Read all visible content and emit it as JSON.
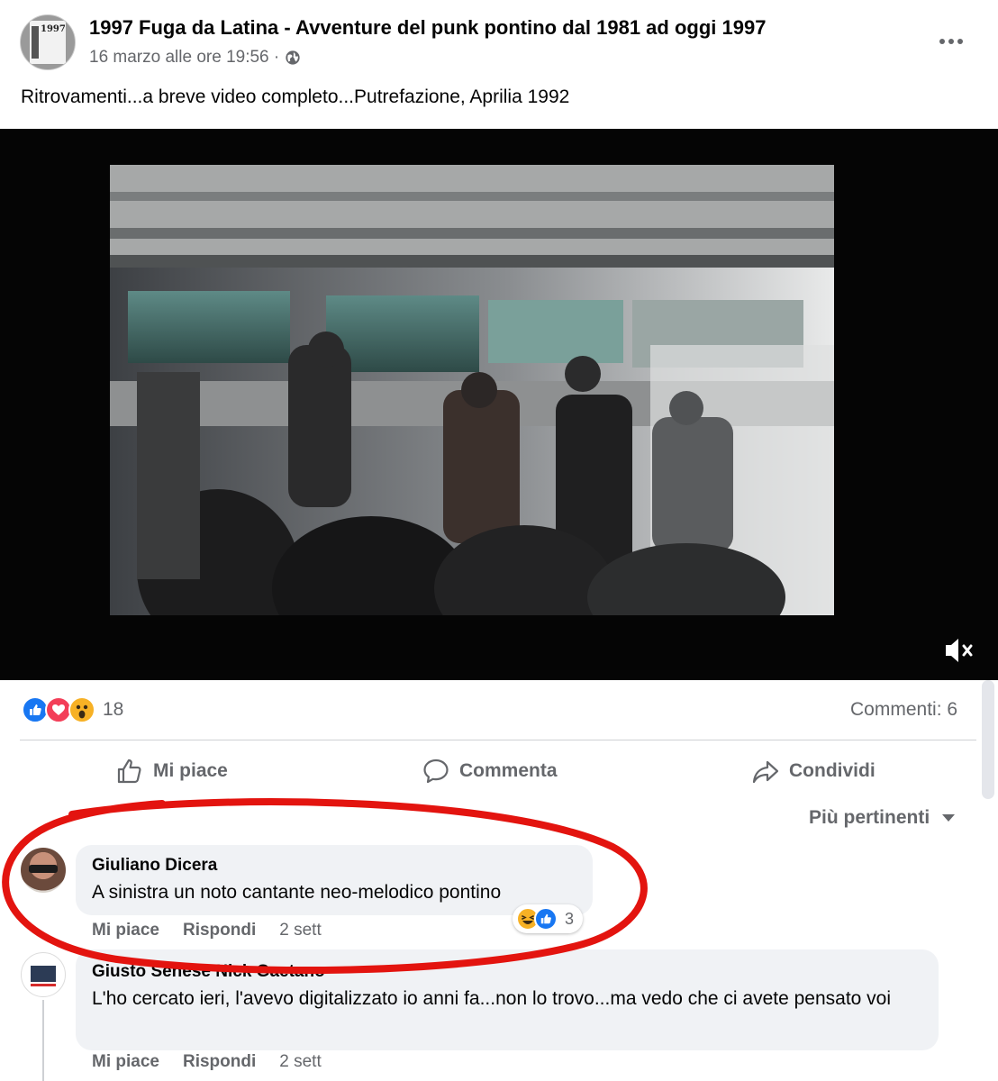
{
  "post": {
    "page_name": "1997 Fuga da Latina - Avventure del punk pontino dal 1981 ad oggi 1997",
    "timestamp": "16 marzo alle ore 19:56 ·",
    "privacy_icon": "globe-icon",
    "text": "Ritrovamenti...a breve video completo...Putrefazione, Aprilia 1992",
    "avatar_text": "1997"
  },
  "video": {
    "muted": true,
    "mute_icon": "speaker-muted-icon"
  },
  "stats": {
    "reaction_icons": [
      "like-icon",
      "love-icon",
      "wow-icon"
    ],
    "reaction_count": "18",
    "comments_label": "Commenti: 6"
  },
  "actions": {
    "like": "Mi piace",
    "comment": "Commenta",
    "share": "Condividi"
  },
  "sort": {
    "label": "Più pertinenti"
  },
  "comments": [
    {
      "author": "Giuliano Dicera",
      "text": "A sinistra un noto cantante neo-melodico pontino",
      "like": "Mi piace",
      "reply": "Rispondi",
      "time": "2 sett",
      "reaction_icons": [
        "haha-icon",
        "like-icon"
      ],
      "reaction_count": "3"
    },
    {
      "author": "Giusto Senese Nick Gaetano",
      "text": "L'ho cercato ieri, l'avevo digitalizzato io anni fa...non lo trovo...ma vedo che ci avete pensato voi",
      "like": "Mi piace",
      "reply": "Rispondi",
      "time": "2 sett"
    }
  ],
  "colors": {
    "text_primary": "#050505",
    "text_secondary": "#65676b",
    "bubble": "#f0f2f5",
    "like_blue": "#1877f2",
    "annotation_red": "#e3140f"
  }
}
